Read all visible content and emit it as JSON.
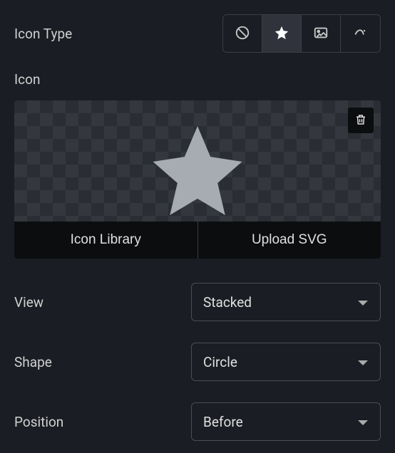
{
  "labels": {
    "icon_type": "Icon Type",
    "icon": "Icon",
    "view": "View",
    "shape": "Shape",
    "position": "Position"
  },
  "icon_type_options": {
    "none": "none-icon",
    "star": "star-icon",
    "image": "image-icon",
    "lottie": "lottie-icon"
  },
  "tabs": {
    "library": "Icon Library",
    "upload": "Upload SVG"
  },
  "selects": {
    "view": "Stacked",
    "shape": "Circle",
    "position": "Before"
  }
}
